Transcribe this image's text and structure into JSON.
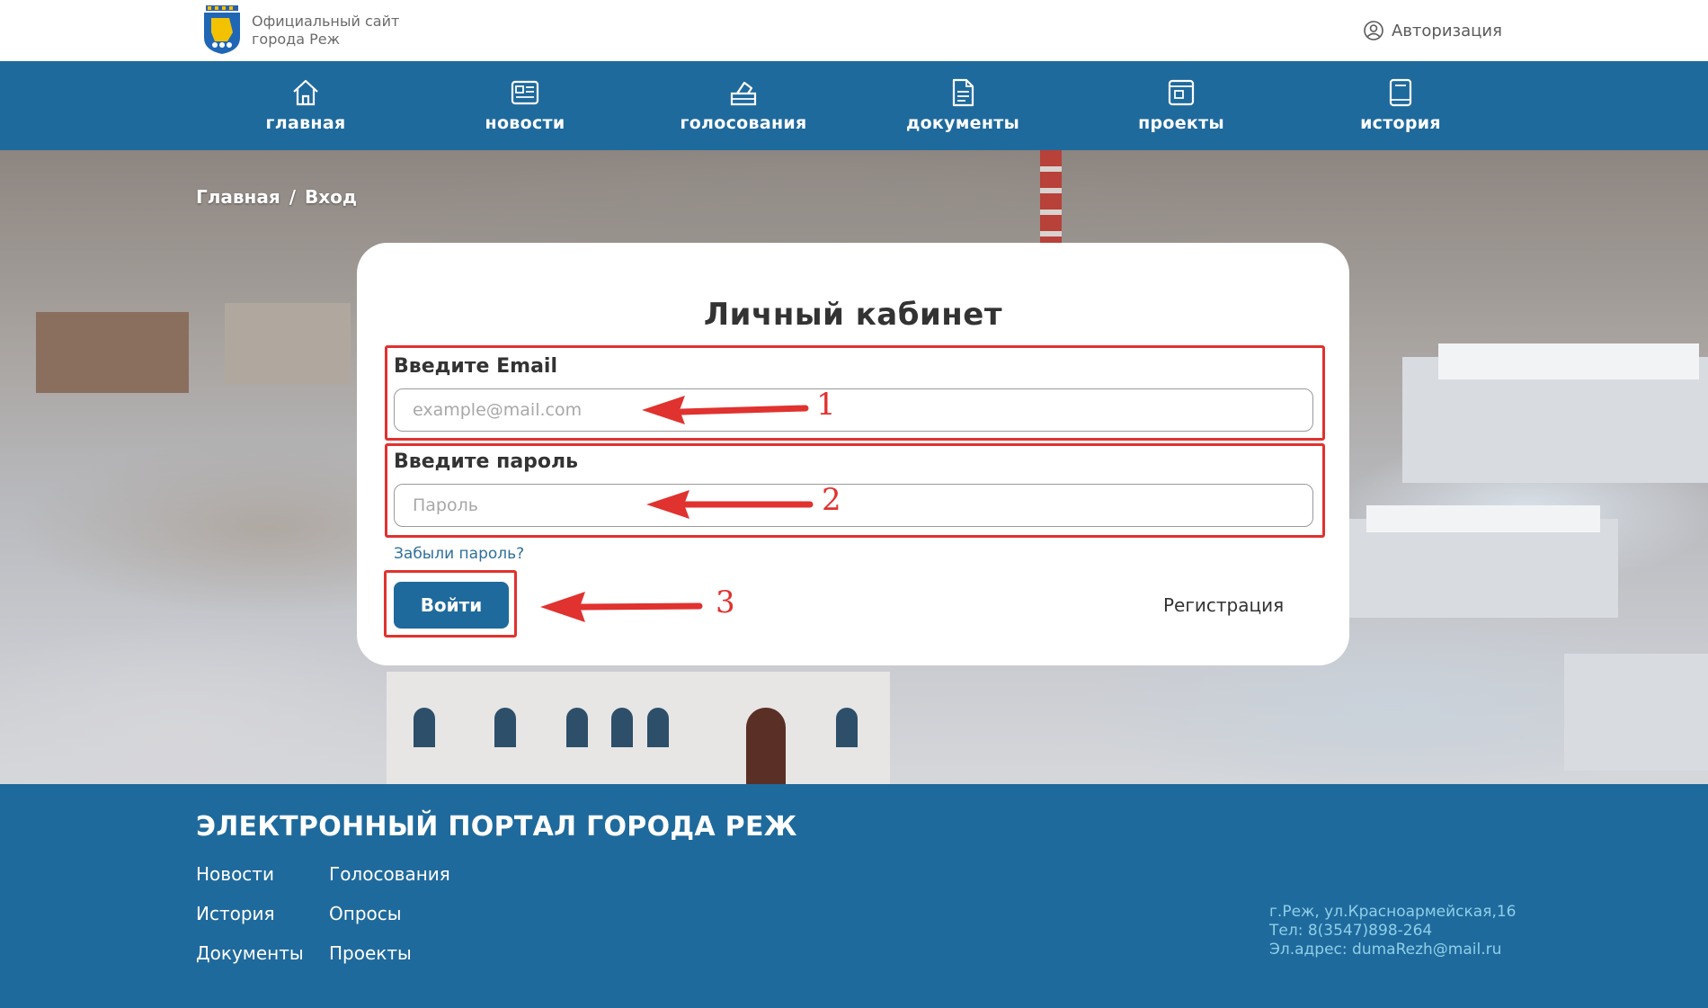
{
  "header": {
    "site_title_line1": "Официальный сайт",
    "site_title_line2": "города Реж",
    "auth_label": "Авторизация",
    "logo_icon": "city-coat-of-arms-icon",
    "user_icon": "user-circle-icon"
  },
  "nav": {
    "items": [
      {
        "label": "главная",
        "icon": "home-icon"
      },
      {
        "label": "новости",
        "icon": "newspaper-icon"
      },
      {
        "label": "голосования",
        "icon": "ballot-box-icon"
      },
      {
        "label": "документы",
        "icon": "document-icon"
      },
      {
        "label": "проекты",
        "icon": "project-icon"
      },
      {
        "label": "история",
        "icon": "book-icon"
      }
    ]
  },
  "breadcrumb": {
    "home": "Главная",
    "separator": "/",
    "current": "Вход"
  },
  "login": {
    "title": "Личный кабинет",
    "email_label": "Введите Email",
    "email_placeholder": "example@mail.com",
    "email_value": "",
    "password_label": "Введите пароль",
    "password_placeholder": "Пароль",
    "password_value": "",
    "forgot_label": "Забыли пароль?",
    "submit_label": "Войти",
    "register_label": "Регистрация"
  },
  "annotations": {
    "step1": "1",
    "step2": "2",
    "step3": "3",
    "color": "#e0322f"
  },
  "footer": {
    "title": "ЭЛЕКТРОННЫЙ ПОРТАЛ ГОРОДА РЕЖ",
    "links_col1": [
      "Новости",
      "История",
      "Документы"
    ],
    "links_col2": [
      "Голосования",
      "Опросы",
      "Проекты"
    ],
    "address": "г.Реж, ул.Красноармейская,16",
    "phone": "Тел: 8(3547)898-264",
    "email": "Эл.адрес: dumaRezh@mail.ru"
  },
  "colors": {
    "brand_blue": "#1f6a9c",
    "contact_text": "#8ecfe8"
  }
}
